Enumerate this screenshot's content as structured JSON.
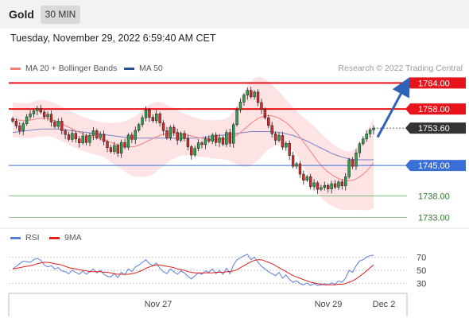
{
  "header": {
    "symbol": "Gold",
    "timeframe": "30 MIN",
    "datetime": "Tuesday, November 29, 2022 6:59:40 AM CET",
    "credit": "Research © 2022 Trading Central"
  },
  "legend": {
    "ma20_label": "MA 20 + Bollinger Bands",
    "ma50_label": "MA 50",
    "rsi_label": "RSI",
    "rsi_ma_label": "9MA"
  },
  "colors": {
    "up_candle": "#ffffff",
    "down_candle": "#2b2b2b",
    "bollinger_fill": "#fddede",
    "ma20": "#f2817a",
    "ma50": "#7b7fc4",
    "resistance": "#e8141b",
    "current": "#333333",
    "support_pivot": "#3b6fd8",
    "support": "#6bb56b",
    "rsi": "#5b7fdc",
    "rsi_ma": "#e31e1e",
    "arrow": "#2f63b7"
  },
  "chart_data": [
    {
      "type": "candlestick",
      "title": "",
      "ylim": [
        1730,
        1767
      ],
      "x_labels": [
        "Nov 27",
        "Nov 29",
        "Dec 2"
      ],
      "levels": [
        {
          "value": 1764.0,
          "label": "1764.00",
          "kind": "resistance"
        },
        {
          "value": 1758.0,
          "label": "1758.00",
          "kind": "resistance"
        },
        {
          "value": 1753.6,
          "label": "1753.60",
          "kind": "current"
        },
        {
          "value": 1745.0,
          "label": "1745.00",
          "kind": "pivot"
        },
        {
          "value": 1738.0,
          "label": "1738.00",
          "kind": "support"
        },
        {
          "value": 1733.0,
          "label": "1733.00",
          "kind": "support"
        }
      ],
      "forecast": {
        "from": 1751.5,
        "to": 1764.0
      },
      "close": [
        1755.2,
        1754.1,
        1753.0,
        1754.6,
        1756.2,
        1756.9,
        1757.6,
        1758.1,
        1757.3,
        1756.2,
        1756.8,
        1755.0,
        1754.0,
        1755.2,
        1753.0,
        1752.1,
        1751.0,
        1752.4,
        1751.1,
        1750.2,
        1751.8,
        1750.3,
        1751.9,
        1753.0,
        1751.4,
        1752.2,
        1750.5,
        1749.1,
        1748.2,
        1749.6,
        1747.8,
        1750.3,
        1749.2,
        1752.0,
        1751.0,
        1753.1,
        1754.4,
        1756.0,
        1757.8,
        1756.1,
        1755.3,
        1756.9,
        1754.8,
        1753.0,
        1751.4,
        1753.8,
        1752.6,
        1750.8,
        1752.4,
        1751.2,
        1749.3,
        1747.4,
        1748.9,
        1750.2,
        1749.8,
        1751.1,
        1750.6,
        1752.0,
        1750.3,
        1751.4,
        1749.9,
        1752.6,
        1750.1,
        1754.4,
        1757.8,
        1759.6,
        1761.2,
        1762.3,
        1760.8,
        1761.9,
        1759.5,
        1757.9,
        1756.0,
        1754.2,
        1752.3,
        1750.8,
        1751.9,
        1749.2,
        1750.1,
        1747.3,
        1744.8,
        1745.4,
        1743.0,
        1741.6,
        1742.4,
        1740.1,
        1741.0,
        1739.5,
        1739.9,
        1740.4,
        1739.6,
        1740.8,
        1740.0,
        1741.2,
        1740.3,
        1742.4,
        1746.3,
        1744.8,
        1747.9,
        1750.0,
        1751.1,
        1752.3,
        1753.2,
        1753.6
      ],
      "ma20": [
        1755.6,
        1755.5,
        1755.4,
        1755.3,
        1755.3,
        1755.4,
        1755.6,
        1755.8,
        1755.9,
        1755.9,
        1755.8,
        1755.6,
        1755.3,
        1755.0,
        1754.6,
        1754.2,
        1753.8,
        1753.4,
        1753.0,
        1752.6,
        1752.3,
        1752.0,
        1751.7,
        1751.5,
        1751.3,
        1751.1,
        1750.9,
        1750.6,
        1750.3,
        1750.0,
        1749.8,
        1749.6,
        1749.4,
        1749.3,
        1749.3,
        1749.4,
        1749.7,
        1750.0,
        1750.4,
        1750.8,
        1751.2,
        1751.6,
        1751.9,
        1752.1,
        1752.3,
        1752.4,
        1752.4,
        1752.4,
        1752.3,
        1752.2,
        1752.0,
        1751.8,
        1751.6,
        1751.4,
        1751.3,
        1751.2,
        1751.1,
        1751.0,
        1751.0,
        1751.0,
        1751.0,
        1751.1,
        1751.3,
        1751.6,
        1752.0,
        1752.6,
        1753.3,
        1754.0,
        1754.7,
        1755.3,
        1755.8,
        1756.2,
        1756.4,
        1756.5,
        1756.4,
        1756.2,
        1755.9,
        1755.4,
        1754.9,
        1754.2,
        1753.4,
        1752.5,
        1751.5,
        1750.4,
        1749.3,
        1748.2,
        1747.1,
        1746.0,
        1745.0,
        1744.2,
        1743.5,
        1742.9,
        1742.4,
        1742.0,
        1741.7,
        1741.5,
        1741.5,
        1741.6,
        1741.9,
        1742.4,
        1743.0,
        1743.7,
        1744.6,
        1745.6
      ],
      "bb_upper": [
        1759.6,
        1759.5,
        1759.4,
        1759.3,
        1759.3,
        1759.4,
        1759.8,
        1760.0,
        1760.2,
        1760.1,
        1759.9,
        1759.6,
        1759.3,
        1759.0,
        1758.6,
        1758.2,
        1757.8,
        1757.4,
        1757.0,
        1756.6,
        1756.2,
        1755.9,
        1755.6,
        1755.4,
        1755.2,
        1755.0,
        1754.9,
        1754.8,
        1754.8,
        1754.8,
        1754.9,
        1755.0,
        1755.2,
        1755.5,
        1755.9,
        1756.4,
        1757.0,
        1757.7,
        1758.4,
        1759.0,
        1759.4,
        1759.6,
        1759.6,
        1759.4,
        1759.0,
        1758.6,
        1758.2,
        1757.8,
        1757.4,
        1757.0,
        1756.6,
        1756.3,
        1756.0,
        1755.8,
        1755.6,
        1755.5,
        1755.4,
        1755.4,
        1755.4,
        1755.5,
        1755.6,
        1755.9,
        1756.5,
        1757.5,
        1758.8,
        1760.4,
        1762.0,
        1763.4,
        1764.4,
        1765.1,
        1765.4,
        1765.3,
        1764.9,
        1764.3,
        1763.6,
        1762.8,
        1762.0,
        1761.1,
        1760.2,
        1759.3,
        1758.4,
        1757.6,
        1756.8,
        1756.1,
        1755.4,
        1754.7,
        1754.0,
        1753.2,
        1752.4,
        1751.6,
        1750.8,
        1750.1,
        1749.5,
        1749.0,
        1748.6,
        1748.3,
        1748.2,
        1748.4,
        1749.0,
        1750.0,
        1751.3,
        1752.8,
        1754.4,
        1756.0
      ],
      "bb_lower": [
        1751.6,
        1751.5,
        1751.4,
        1751.3,
        1751.3,
        1751.4,
        1751.4,
        1751.6,
        1751.6,
        1751.7,
        1751.7,
        1751.6,
        1751.3,
        1751.0,
        1750.6,
        1750.2,
        1749.8,
        1749.4,
        1749.0,
        1748.6,
        1748.4,
        1748.1,
        1747.8,
        1747.6,
        1747.4,
        1747.2,
        1746.9,
        1746.4,
        1745.8,
        1745.2,
        1744.7,
        1744.2,
        1743.6,
        1743.1,
        1742.7,
        1742.4,
        1742.4,
        1742.3,
        1742.4,
        1742.6,
        1743.0,
        1743.6,
        1744.2,
        1744.8,
        1745.6,
        1746.2,
        1746.6,
        1747.0,
        1747.2,
        1747.4,
        1747.4,
        1747.3,
        1747.2,
        1747.0,
        1747.0,
        1746.9,
        1746.8,
        1746.6,
        1746.6,
        1746.5,
        1746.4,
        1746.3,
        1746.1,
        1745.7,
        1745.2,
        1744.8,
        1744.6,
        1744.6,
        1745.0,
        1745.5,
        1746.2,
        1747.1,
        1747.9,
        1748.7,
        1749.2,
        1749.6,
        1749.8,
        1749.7,
        1749.6,
        1749.1,
        1748.4,
        1747.4,
        1746.2,
        1744.7,
        1743.2,
        1741.7,
        1740.2,
        1738.8,
        1737.6,
        1736.8,
        1736.2,
        1735.7,
        1735.3,
        1735.0,
        1734.8,
        1734.7,
        1734.8,
        1734.8,
        1734.8,
        1734.8,
        1734.7,
        1734.6,
        1734.8,
        1735.2
      ],
      "ma50": [
        1752.6,
        1752.7,
        1752.8,
        1752.9,
        1753.0,
        1753.1,
        1753.2,
        1753.3,
        1753.4,
        1753.4,
        1753.4,
        1753.4,
        1753.4,
        1753.4,
        1753.3,
        1753.2,
        1753.1,
        1753.0,
        1752.9,
        1752.8,
        1752.7,
        1752.6,
        1752.5,
        1752.4,
        1752.3,
        1752.2,
        1752.1,
        1752.0,
        1751.9,
        1751.8,
        1751.7,
        1751.6,
        1751.5,
        1751.4,
        1751.4,
        1751.3,
        1751.3,
        1751.3,
        1751.3,
        1751.3,
        1751.3,
        1751.3,
        1751.3,
        1751.3,
        1751.3,
        1751.3,
        1751.3,
        1751.3,
        1751.3,
        1751.3,
        1751.3,
        1751.3,
        1751.3,
        1751.3,
        1751.4,
        1751.5,
        1751.6,
        1751.7,
        1751.8,
        1751.9,
        1752.0,
        1752.1,
        1752.2,
        1752.3,
        1752.4,
        1752.5,
        1752.6,
        1752.7,
        1752.8,
        1752.8,
        1752.8,
        1752.8,
        1752.8,
        1752.8,
        1752.8,
        1752.7,
        1752.6,
        1752.5,
        1752.3,
        1752.1,
        1751.9,
        1751.6,
        1751.3,
        1751.0,
        1750.6,
        1750.2,
        1749.8,
        1749.4,
        1749.0,
        1748.6,
        1748.2,
        1747.8,
        1747.5,
        1747.2,
        1746.9,
        1746.7,
        1746.5,
        1746.4,
        1746.3,
        1746.3,
        1746.3,
        1746.3,
        1746.3,
        1746.3
      ]
    },
    {
      "type": "line",
      "title": "",
      "ylim": [
        20,
        80
      ],
      "ticks": [
        "70",
        "50",
        "30"
      ],
      "series": [
        {
          "name": "RSI",
          "values": [
            52,
            56,
            60,
            64,
            63,
            62,
            66,
            68,
            65,
            58,
            55,
            57,
            52,
            54,
            49,
            48,
            45,
            50,
            47,
            44,
            49,
            44,
            48,
            52,
            46,
            50,
            44,
            41,
            40,
            45,
            39,
            47,
            43,
            52,
            48,
            55,
            58,
            62,
            66,
            60,
            57,
            61,
            53,
            48,
            45,
            52,
            48,
            44,
            49,
            46,
            41,
            37,
            42,
            46,
            44,
            49,
            47,
            52,
            45,
            50,
            44,
            53,
            45,
            58,
            66,
            69,
            72,
            74,
            66,
            70,
            62,
            56,
            52,
            48,
            45,
            42,
            47,
            38,
            43,
            36,
            32,
            34,
            30,
            28,
            31,
            27,
            30,
            27,
            28,
            30,
            28,
            31,
            29,
            34,
            32,
            38,
            50,
            47,
            57,
            64,
            66,
            70,
            72,
            73
          ]
        },
        {
          "name": "9MA",
          "values": [
            52,
            53,
            54,
            55,
            56,
            57,
            58,
            60,
            61,
            62,
            62,
            61,
            60,
            59,
            58,
            56,
            54,
            53,
            52,
            51,
            50,
            49,
            48,
            48,
            48,
            48,
            47,
            47,
            46,
            45,
            44,
            44,
            44,
            44,
            45,
            46,
            48,
            50,
            53,
            55,
            57,
            58,
            58,
            57,
            56,
            55,
            54,
            52,
            51,
            50,
            48,
            47,
            46,
            46,
            46,
            46,
            46,
            46,
            47,
            47,
            47,
            48,
            48,
            49,
            51,
            54,
            57,
            60,
            63,
            65,
            66,
            66,
            64,
            62,
            60,
            57,
            54,
            51,
            48,
            45,
            42,
            40,
            38,
            36,
            34,
            32,
            31,
            30,
            29,
            28,
            28,
            28,
            28,
            29,
            29,
            30,
            32,
            34,
            37,
            41,
            45,
            49,
            54,
            58
          ]
        }
      ]
    }
  ]
}
